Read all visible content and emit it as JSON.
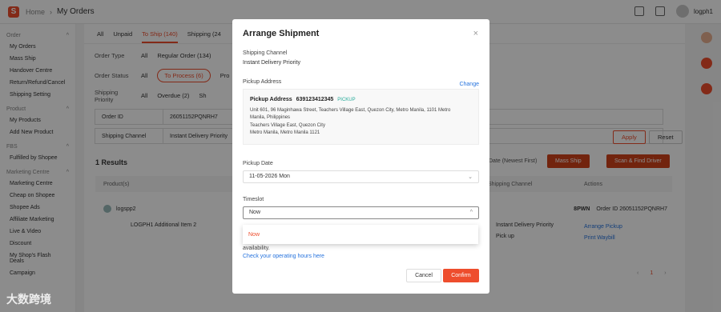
{
  "header": {
    "logo": "S",
    "breadcrumb": [
      "Home",
      "My Orders"
    ],
    "username": "logph1"
  },
  "sidebar": {
    "groups": [
      {
        "title": "Order",
        "items": [
          "My Orders",
          "Mass Ship",
          "Handover Centre",
          "Return/Refund/Cancel",
          "Shipping Setting"
        ]
      },
      {
        "title": "Product",
        "items": [
          "My Products",
          "Add New Product"
        ]
      },
      {
        "title": "FBS",
        "items": [
          "Fulfilled by Shopee"
        ]
      },
      {
        "title": "Marketing Centre",
        "items": [
          "Marketing Centre",
          "Cheap on Shopee",
          "Shopee Ads",
          "Affiliate Marketing",
          "Live & Video",
          "Discount",
          "My Shop's Flash Deals",
          "Campaign"
        ]
      }
    ]
  },
  "main": {
    "tabs": [
      "All",
      "Unpaid",
      "To Ship (140)",
      "Shipping (24"
    ],
    "filters": {
      "order_type_label": "Order Type",
      "order_type_all": "All",
      "order_type_regular": "Regular Order (134)",
      "order_status_label": "Order Status",
      "order_status_all": "All",
      "order_status_pill": "To Process (6)",
      "order_status_more": "Pro",
      "priority_label": "Shipping Priority",
      "priority_all": "All",
      "priority_overdue": "Overdue (2)",
      "priority_more": "Sh"
    },
    "search": {
      "field": "Order ID",
      "value": "26051152PQNRH7"
    },
    "channel": {
      "field": "Shipping Channel",
      "value": "Instant Delivery Priority"
    },
    "apply": "Apply",
    "reset": "Reset",
    "results": "1 Results",
    "sort": "Date (Newest First)",
    "mass_ship": "Mass Ship",
    "scan": "Scan & Find Driver",
    "columns": [
      "Product(s)",
      "Shipping Channel",
      "Actions"
    ],
    "order": {
      "buyer": "logspp2",
      "code": "8PWN",
      "order_id": "Order ID 26051152PQNRH7",
      "product": "LOGPH1 Additional Item 2",
      "channel": "Instant Delivery Priority",
      "channel_sub": "Pick up",
      "action1": "Arrange Pickup",
      "action2": "Print Waybill"
    },
    "page": "1"
  },
  "modal": {
    "title": "Arrange Shipment",
    "close": "×",
    "shipping_channel_label": "Shipping Channel",
    "shipping_channel_value": "Instant Delivery Priority",
    "pickup_address_label": "Pickup Address",
    "change": "Change",
    "address": {
      "head": "Pickup Address",
      "phone": "639123412345",
      "tag": "PICKUP",
      "line1": "Unit 601, 96 Maginhawa Street, Teachers Village East, Quezon City, Metro Manila, 1101 Metro",
      "line2": "Manila, Philippines",
      "line3": "Teachers Village East, Quezon City",
      "line4": "Metro Manila, Metro Manila 1121"
    },
    "pickup_date_label": "Pickup Date",
    "pickup_date_value": "11-05-2026 Mon",
    "timeslot_label": "Timeslot",
    "timeslot_value": "Now",
    "dropdown_option": "Now",
    "note_line1": "availability.",
    "note_link": "Check your operating hours here",
    "cancel": "Cancel",
    "confirm": "Confirm"
  },
  "watermark": "大数跨境"
}
